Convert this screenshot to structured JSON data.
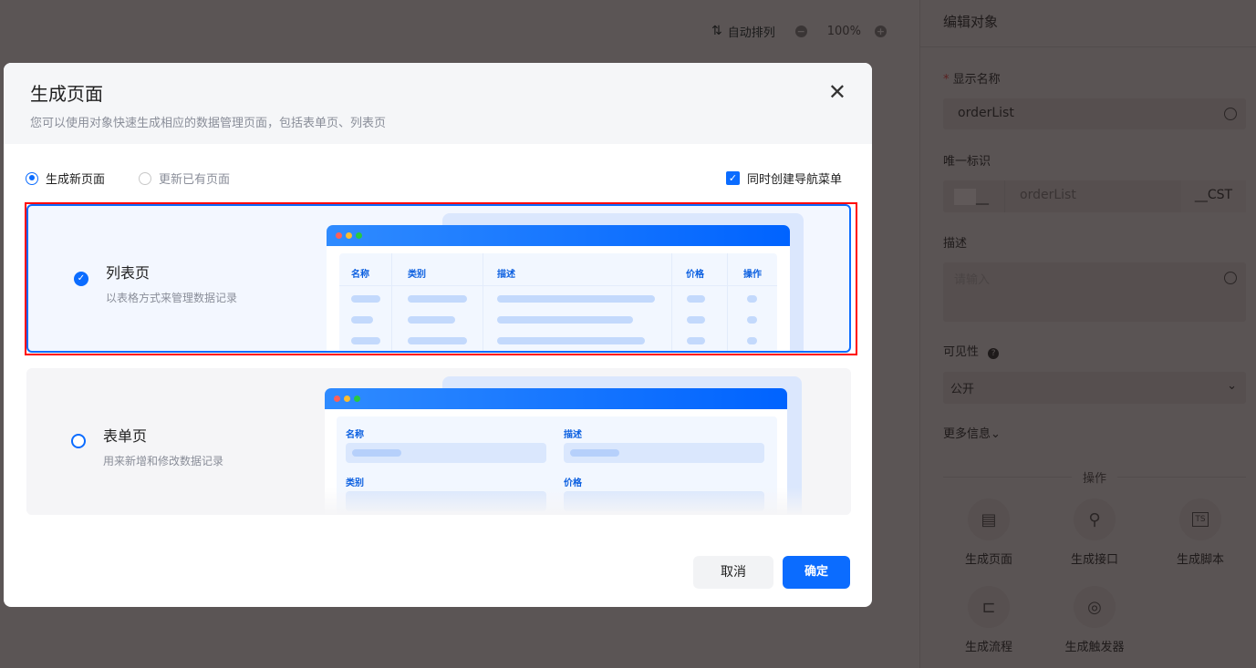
{
  "toolbar": {
    "auto_arrange": "自动排列",
    "zoom": "100%"
  },
  "panel": {
    "title": "编辑对象",
    "display_name_label": "显示名称",
    "display_name_value": "orderList",
    "unique_id_label": "唯一标识",
    "unique_id_prefix": "__",
    "unique_id_value": "orderList",
    "unique_id_suffix": "__CST",
    "desc_label": "描述",
    "desc_placeholder": "请输入",
    "visibility_label": "可见性",
    "visibility_value": "公开",
    "more_info": "更多信息",
    "actions_title": "操作",
    "actions": [
      {
        "label": "生成页面",
        "icon": "document-icon"
      },
      {
        "label": "生成接口",
        "icon": "plug-icon"
      },
      {
        "label": "生成脚本",
        "icon": "ts-icon"
      },
      {
        "label": "生成流程",
        "icon": "flow-icon"
      },
      {
        "label": "生成触发器",
        "icon": "trigger-icon"
      }
    ]
  },
  "modal": {
    "title": "生成页面",
    "subtitle": "您可以使用对象快速生成相应的数据管理页面，包括表单页、列表页",
    "radio_new": "生成新页面",
    "radio_update": "更新已有页面",
    "checkbox_nav": "同时创建导航菜单",
    "list_card": {
      "title": "列表页",
      "desc": "以表格方式来管理数据记录",
      "columns": [
        "名称",
        "类别",
        "描述",
        "价格",
        "操作"
      ],
      "selected": true
    },
    "form_card": {
      "title": "表单页",
      "desc": "用来新增和修改数据记录",
      "fields": [
        "名称",
        "描述",
        "类别",
        "价格"
      ],
      "selected": false
    },
    "cancel": "取消",
    "confirm": "确定"
  },
  "colors": {
    "accent": "#0b6cff",
    "highlight": "#ff0000"
  }
}
